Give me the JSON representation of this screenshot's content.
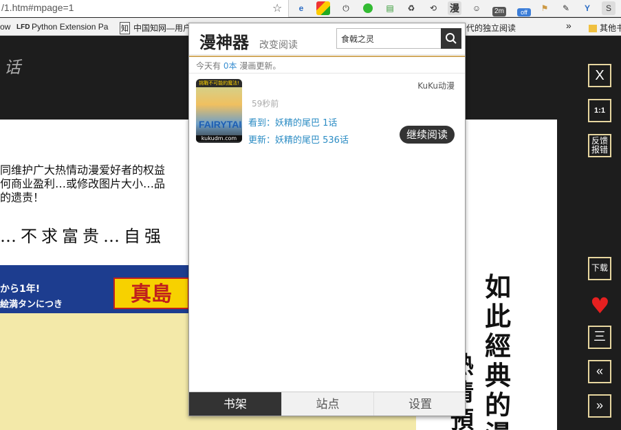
{
  "browser": {
    "url": "/1.htm#mpage=1",
    "extensions": [
      "edge-icon",
      "chrome-icon",
      "power-icon",
      "record-icon",
      "doc-icon",
      "recycle-icon",
      "refresh-icon",
      "manga-icon",
      "ninja-icon",
      "2m-icon",
      "off-icon",
      "flag-icon",
      "eyedropper-icon",
      "y-icon",
      "s-icon"
    ],
    "ext_labels": {
      "manga": "漫",
      "twom": "2m",
      "off": "off"
    },
    "bookmarks": [
      "ow",
      "LFD",
      "Python Extension Pa",
      "知",
      "中国知网—用户",
      "代的独立阅读",
      "»",
      "其他书"
    ]
  },
  "reader": {
    "chapter_label": "话",
    "comic_lines": [
      "同维护广大热情动漫爱好者的权益",
      "何商业盈利…或修改图片大小…品",
      "的遗责！"
    ],
    "slogan": "…不求富贵…自强",
    "cover_band": "から1年!",
    "cover_band2": "絵満タンにつき",
    "cover_title": "真島",
    "vertical_text": "如此經典的漫",
    "vertical_text2": "熱情預",
    "side": {
      "close": "X",
      "ratio": "1:1",
      "feedback": "反馈\n报错",
      "download": "下载",
      "menu": "三",
      "prev": "«",
      "next": "»"
    }
  },
  "popup": {
    "brand": "漫神器",
    "tagline": "改变阅读",
    "search": {
      "value": "食戟之灵",
      "placeholder": ""
    },
    "info_prefix": "今天有",
    "info_count": "0本",
    "info_suffix": "漫画更新。",
    "item": {
      "site": "KuKu动漫",
      "time": "59秒前",
      "seen": "看到：妖精的尾巴 1话",
      "latest": "更新：妖精的尾巴 536话",
      "continue": "继续阅读",
      "thumb_top": "挑戰不可能的魔法!",
      "thumb_logo": "FAIRYTAIL",
      "thumb_url": "kukudm.com"
    },
    "tabs": [
      "书架",
      "站点",
      "设置"
    ],
    "active_tab": 0
  },
  "colors": {
    "accent": "#2b8cc4",
    "gold_border": "#e8d7a0",
    "heart": "#e62020"
  }
}
